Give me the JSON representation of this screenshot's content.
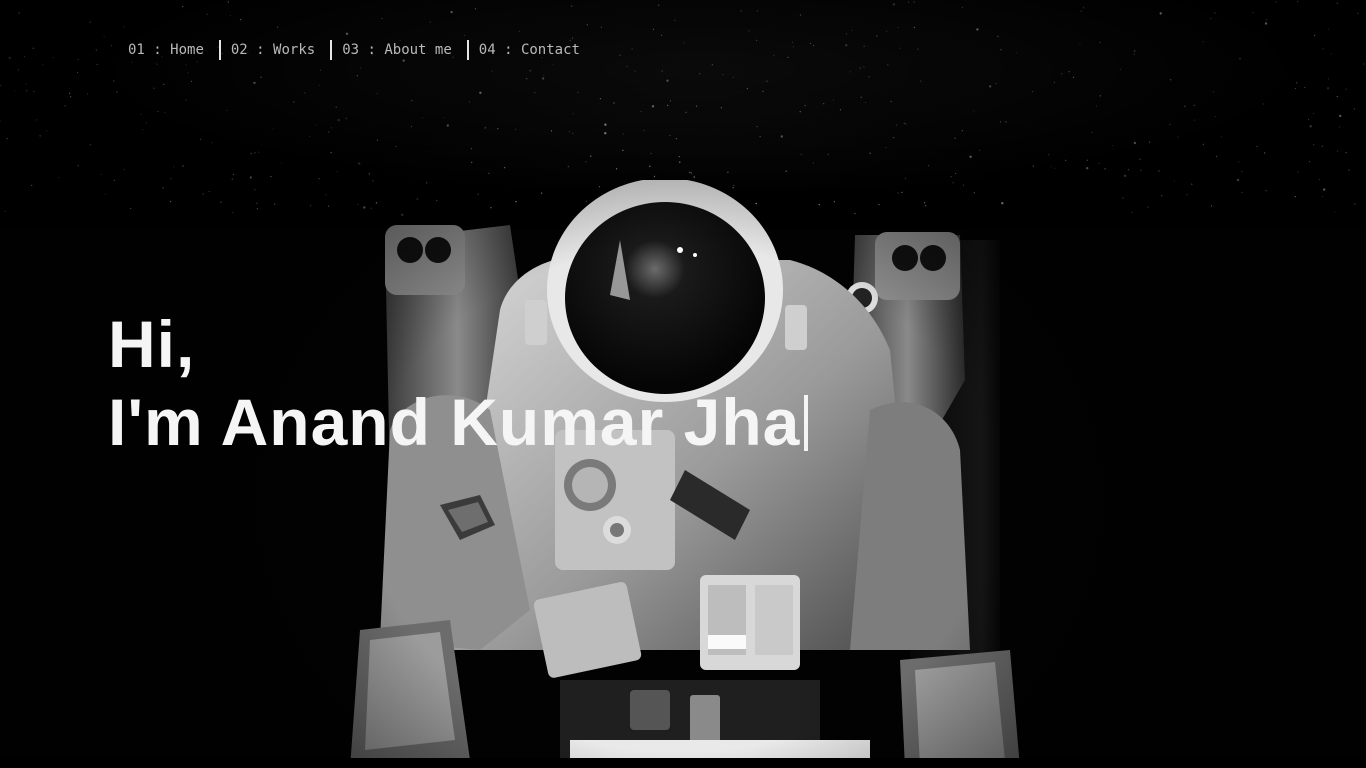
{
  "nav": {
    "items": [
      {
        "number": "01",
        "sep": " : ",
        "label": "Home"
      },
      {
        "number": "02",
        "sep": " : ",
        "label": "Works"
      },
      {
        "number": "03",
        "sep": " : ",
        "label": "About me"
      },
      {
        "number": "04",
        "sep": " : ",
        "label": "Contact"
      }
    ]
  },
  "hero": {
    "greeting": "Hi,",
    "intro": "I'm Anand Kumar Jha",
    "image": "astronaut-photo"
  },
  "colors": {
    "background": "#000000",
    "text": "#f5f5f5",
    "nav_text": "#b9b9b9"
  }
}
